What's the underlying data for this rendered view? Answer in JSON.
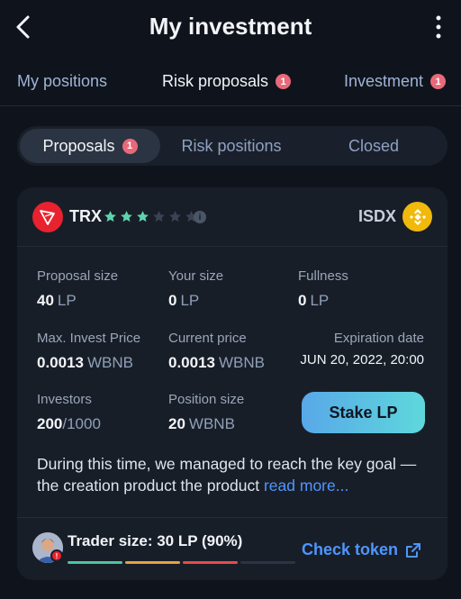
{
  "header": {
    "title": "My investment",
    "back_icon": "chevron-left-icon",
    "menu_icon": "more-vertical-icon"
  },
  "tabs": [
    {
      "label": "My positions",
      "badge": ""
    },
    {
      "label": "Risk proposals",
      "badge": "1"
    },
    {
      "label": "Investment",
      "badge": "1"
    }
  ],
  "segments": [
    {
      "label": "Proposals",
      "badge": "1"
    },
    {
      "label": "Risk positions"
    },
    {
      "label": "Closed"
    }
  ],
  "card": {
    "token": "TRX",
    "rating": 3,
    "rating_max": 6,
    "quote_token": "ISDX",
    "stats": {
      "proposal_size": {
        "label": "Proposal size",
        "value": "40",
        "unit": "LP"
      },
      "your_size": {
        "label": "Your size",
        "value": "0",
        "unit": "LP"
      },
      "fullness": {
        "label": "Fullness",
        "value": "0",
        "unit": "LP"
      },
      "max_invest_price": {
        "label": "Max. Invest Price",
        "value": "0.0013",
        "unit": "WBNB"
      },
      "current_price": {
        "label": "Current price",
        "value": "0.0013",
        "unit": "WBNB"
      },
      "expiration": {
        "label": "Expiration date",
        "value": "JUN 20, 2022, 20:00"
      },
      "investors": {
        "label": "Investors",
        "value": "200",
        "max": "/1000"
      },
      "position_size": {
        "label": "Position size",
        "value": "20",
        "unit": "WBNB"
      }
    },
    "stake_label": "Stake LP",
    "description": "During this time, we managed to reach the key goal — the creation product the product",
    "read_more": "read more...",
    "trader_size": "Trader size: 30 LP (90%)",
    "check_token": "Check token",
    "alert_mark": "!",
    "info_mark": "i"
  },
  "colors": {
    "accent_blue": "#4e96ff",
    "badge_red": "#e8697a",
    "star_active": "#5fd3b0",
    "star_inactive": "#3a4352",
    "bar_colors": [
      "#4cc4a0",
      "#e8a23a",
      "#e84a4a",
      "#2b3442"
    ]
  }
}
